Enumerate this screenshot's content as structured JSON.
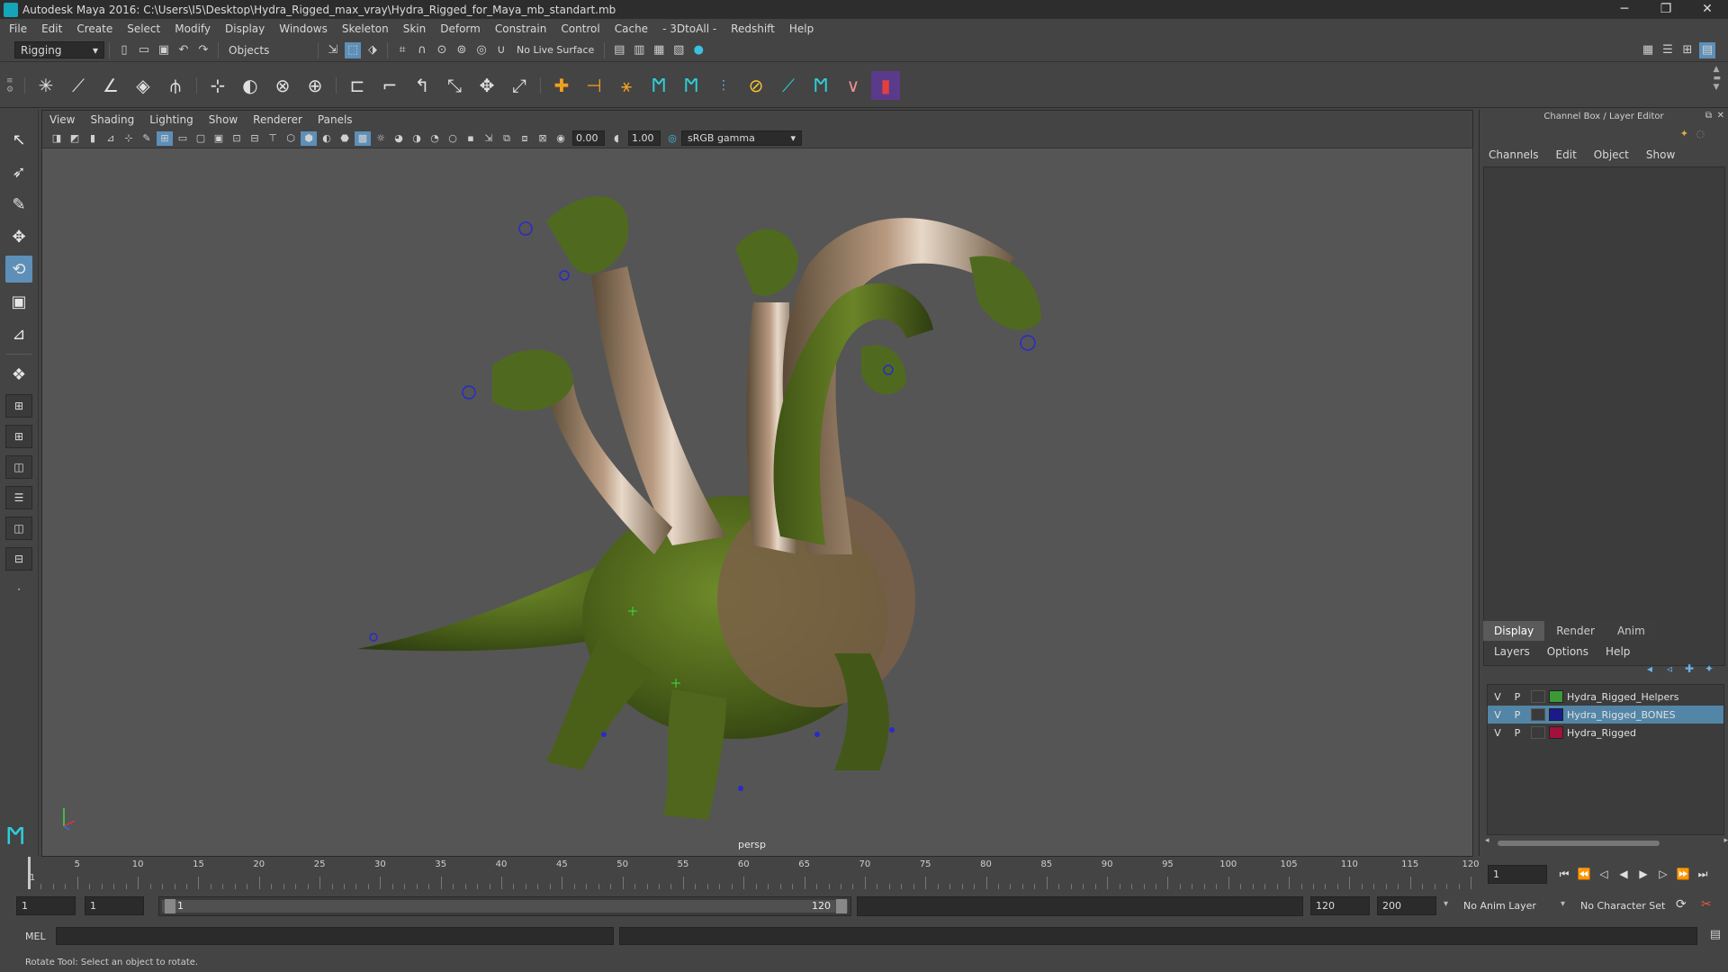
{
  "window": {
    "title": "Autodesk Maya 2016: C:\\Users\\I5\\Desktop\\Hydra_Rigged_max_vray\\Hydra_Rigged_for_Maya_mb_standart.mb",
    "minimize": "─",
    "restore": "❐",
    "close": "✕"
  },
  "menubar": [
    "File",
    "Edit",
    "Create",
    "Select",
    "Modify",
    "Display",
    "Windows",
    "Skeleton",
    "Skin",
    "Deform",
    "Constrain",
    "Control",
    "Cache",
    "- 3DtoAll -",
    "Redshift",
    "Help"
  ],
  "statusline": {
    "mode": "Rigging",
    "selection_mode": "Objects",
    "live_surface": "No Live Surface"
  },
  "viewport": {
    "menu": [
      "View",
      "Shading",
      "Lighting",
      "Show",
      "Renderer",
      "Panels"
    ],
    "exposure": "0.00",
    "gamma": "1.00",
    "color_space": "sRGB gamma",
    "camera_label": "persp"
  },
  "channel_box": {
    "title": "Channel Box / Layer Editor",
    "menu": [
      "Channels",
      "Edit",
      "Object",
      "Show"
    ]
  },
  "layer_editor": {
    "tabs": [
      "Display",
      "Render",
      "Anim"
    ],
    "menu": [
      "Layers",
      "Options",
      "Help"
    ],
    "layers": [
      {
        "v": "V",
        "p": "P",
        "name": "Hydra_Rigged_Helpers",
        "color": "#3c9a36",
        "selected": false
      },
      {
        "v": "V",
        "p": "P",
        "name": "Hydra_Rigged_BONES",
        "color": "#1a1a8a",
        "selected": true
      },
      {
        "v": "V",
        "p": "P",
        "name": "Hydra_Rigged",
        "color": "#a0123a",
        "selected": false
      }
    ]
  },
  "timeline": {
    "tick_labels": [
      "1",
      "5",
      "10",
      "15",
      "20",
      "25",
      "30",
      "35",
      "40",
      "45",
      "50",
      "55",
      "60",
      "65",
      "70",
      "75",
      "80",
      "85",
      "90",
      "95",
      "100",
      "105",
      "110",
      "115",
      "120"
    ],
    "current_frame": "1"
  },
  "range": {
    "start": "1",
    "playback_start": "1",
    "slider_start": "1",
    "slider_end": "120",
    "playback_end": "120",
    "end": "200",
    "anim_layer": "No Anim Layer",
    "character_set": "No Character Set"
  },
  "command": {
    "lang": "MEL"
  },
  "helpline": "Rotate Tool: Select an object to rotate."
}
